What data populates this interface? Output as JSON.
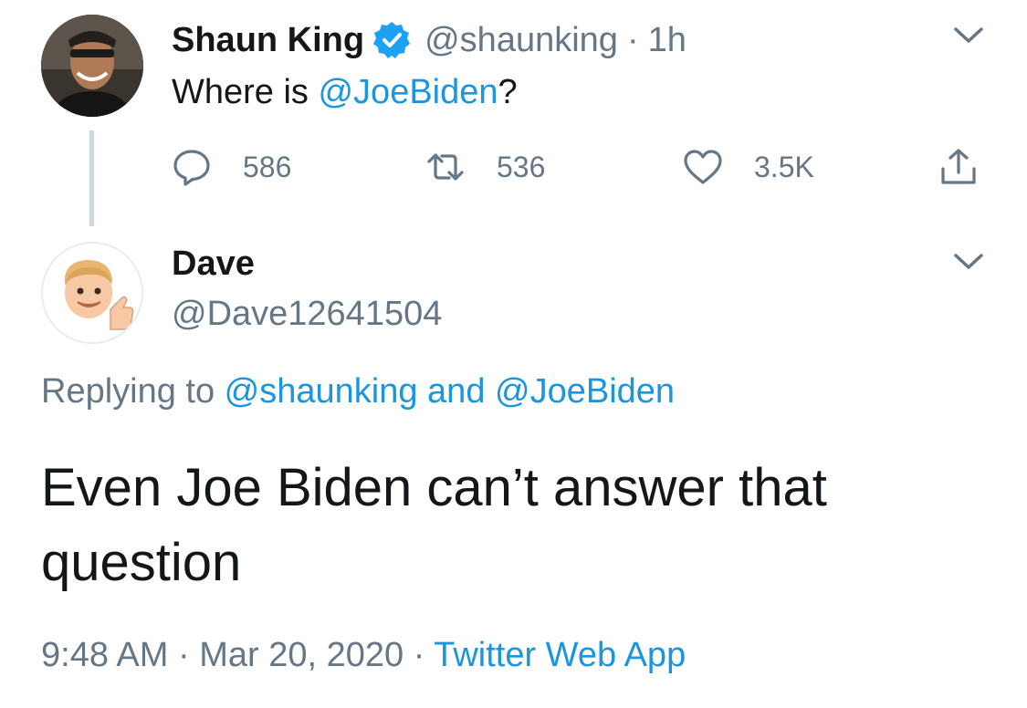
{
  "tweet": {
    "author_name": "Shaun King",
    "author_handle": "@shaunking",
    "separator": "·",
    "relative_time": "1h",
    "text_prefix": "Where is ",
    "text_mention": "@JoeBiden",
    "text_suffix": "?",
    "stats": {
      "replies": "586",
      "retweets": "536",
      "likes": "3.5K"
    }
  },
  "reply": {
    "author_name": "Dave",
    "author_handle": "@Dave12641504",
    "replying_prefix": "Replying to ",
    "replying_mentions": "@shaunking and @JoeBiden",
    "text": "Even Joe Biden can’t answer that question",
    "time": "9:48 AM",
    "separator": "·",
    "date": "Mar 20, 2020",
    "separator2": "·",
    "source": "Twitter Web App"
  },
  "colors": {
    "link": "#1b95e0",
    "muted": "#657786",
    "text": "#14171a",
    "verified": "#1da1f2"
  },
  "icons": {
    "reply": "speech-bubble",
    "retweet": "retweet-arrows",
    "like": "heart-outline",
    "share": "share-upload",
    "menu": "chevron-down"
  }
}
